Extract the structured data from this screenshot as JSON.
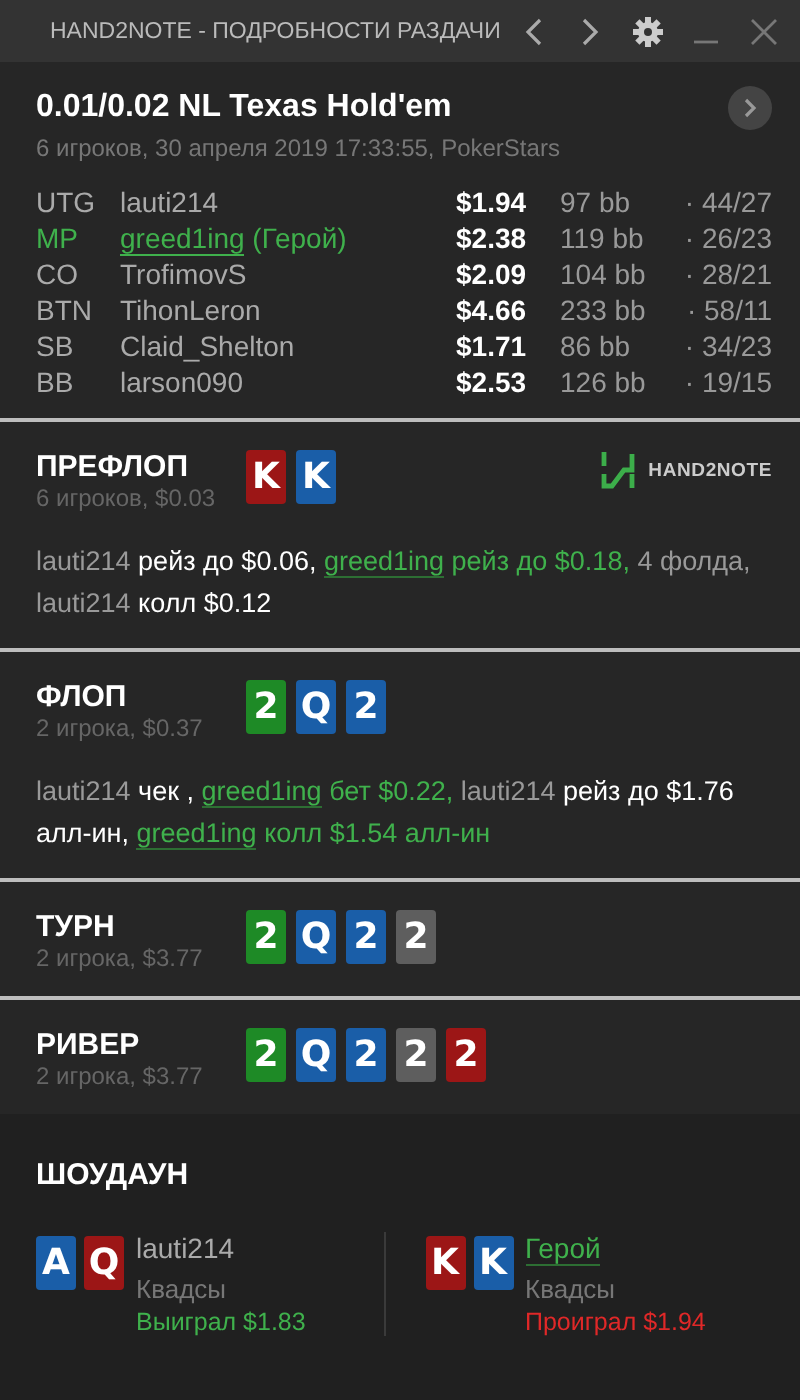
{
  "window": {
    "title": "HAND2NOTE - ПОДРОБНОСТИ РАЗДАЧИ"
  },
  "hand": {
    "title": "0.01/0.02 NL Texas Hold'em",
    "subtitle": "6 игроков, 30 апреля 2019 17:33:55, PokerStars"
  },
  "players": [
    {
      "position": "UTG",
      "name": "lauti214",
      "hero": false,
      "stack": "$1.94",
      "bb": "97 bb",
      "stats": "· 44/27"
    },
    {
      "position": "MP",
      "name": "greed1ing",
      "hero": true,
      "hero_label": "(Герой)",
      "stack": "$2.38",
      "bb": "119 bb",
      "stats": "· 26/23"
    },
    {
      "position": "CO",
      "name": "TrofimovS",
      "hero": false,
      "stack": "$2.09",
      "bb": "104 bb",
      "stats": "· 28/21"
    },
    {
      "position": "BTN",
      "name": "TihonLeron",
      "hero": false,
      "stack": "$4.66",
      "bb": "233 bb",
      "stats": "· 58/11"
    },
    {
      "position": "SB",
      "name": "Claid_Shelton",
      "hero": false,
      "stack": "$1.71",
      "bb": "86 bb",
      "stats": "· 34/23"
    },
    {
      "position": "BB",
      "name": "larson090",
      "hero": false,
      "stack": "$2.53",
      "bb": "126 bb",
      "stats": "· 19/15"
    }
  ],
  "streets": [
    {
      "name": "ПРЕФЛОП",
      "info": "6 игроков, $0.03",
      "logo": "HAND2NOTE",
      "cards": [
        {
          "rank": "K",
          "color": "#9c1616"
        },
        {
          "rank": "K",
          "color": "#1a5ea8"
        }
      ],
      "actions": [
        {
          "kind": "name",
          "text": "lauti214"
        },
        {
          "kind": "act",
          "text": " рейз до $0.06, "
        },
        {
          "kind": "hero-name",
          "text": "greed1ing"
        },
        {
          "kind": "hero-act",
          "text": " рейз до $0.18,"
        },
        {
          "kind": "plain",
          "text": " 4 фолда, lauti214"
        },
        {
          "kind": "act",
          "text": " колл $0.12"
        }
      ]
    },
    {
      "name": "ФЛОП",
      "info": "2 игрока, $0.37",
      "cards": [
        {
          "rank": "2",
          "color": "#1e8a26"
        },
        {
          "rank": "Q",
          "color": "#1a5ea8"
        },
        {
          "rank": "2",
          "color": "#1a5ea8"
        }
      ],
      "actions": [
        {
          "kind": "name",
          "text": "lauti214"
        },
        {
          "kind": "act",
          "text": " чек , "
        },
        {
          "kind": "hero-name",
          "text": "greed1ing"
        },
        {
          "kind": "hero-act",
          "text": " бет $0.22,"
        },
        {
          "kind": "name",
          "text": " lauti214"
        },
        {
          "kind": "act",
          "text": " рейз до $1.76 алл-ин, "
        },
        {
          "kind": "hero-name",
          "text": "greed1ing"
        },
        {
          "kind": "hero-act",
          "text": " колл $1.54 алл-ин"
        }
      ]
    },
    {
      "name": "ТУРН",
      "info": "2 игрока, $3.77",
      "cards": [
        {
          "rank": "2",
          "color": "#1e8a26"
        },
        {
          "rank": "Q",
          "color": "#1a5ea8"
        },
        {
          "rank": "2",
          "color": "#1a5ea8"
        },
        {
          "rank": "2",
          "color": "#5e5e5e"
        }
      ]
    },
    {
      "name": "РИВЕР",
      "info": "2 игрока, $3.77",
      "cards": [
        {
          "rank": "2",
          "color": "#1e8a26"
        },
        {
          "rank": "Q",
          "color": "#1a5ea8"
        },
        {
          "rank": "2",
          "color": "#1a5ea8"
        },
        {
          "rank": "2",
          "color": "#5e5e5e"
        },
        {
          "rank": "2",
          "color": "#9c1616"
        }
      ]
    }
  ],
  "showdown": {
    "title": "ШОУДАУН",
    "hands": [
      {
        "player": "lauti214",
        "hero": false,
        "combo": "Квадсы",
        "result": "Выиграл $1.83",
        "won": true,
        "cards": [
          {
            "rank": "A",
            "color": "#1a5ea8"
          },
          {
            "rank": "Q",
            "color": "#9c1616"
          }
        ]
      },
      {
        "player": "Герой",
        "hero": true,
        "combo": "Квадсы",
        "result": "Проиграл $1.94",
        "won": false,
        "cards": [
          {
            "rank": "K",
            "color": "#9c1616"
          },
          {
            "rank": "K",
            "color": "#1a5ea8"
          }
        ]
      }
    ]
  }
}
